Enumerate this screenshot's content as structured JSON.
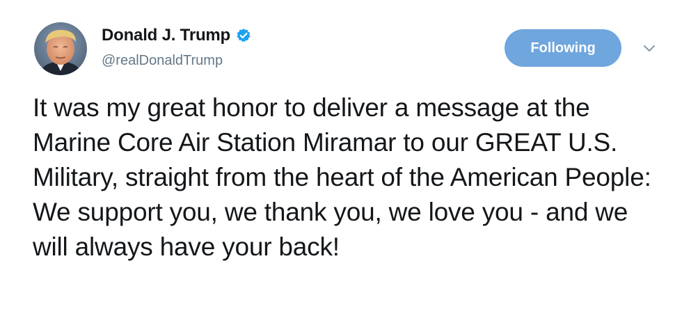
{
  "tweet": {
    "display_name": "Donald J. Trump",
    "handle": "@realDonaldTrump",
    "verified": true,
    "follow_button_label": "Following",
    "text": "It was my great honor to deliver a message at the Marine Core Air Station Miramar to our GREAT U.S. Military, straight from the heart of the American People: We support you, we thank you, we love you - and we will always have your back!"
  },
  "icons": {
    "verified": "verified-badge-icon",
    "menu": "chevron-down-icon"
  },
  "colors": {
    "follow_button": "#6fa6dd",
    "verified_badge": "#1da1f2",
    "handle_text": "#657786",
    "body_text": "#14171a"
  }
}
